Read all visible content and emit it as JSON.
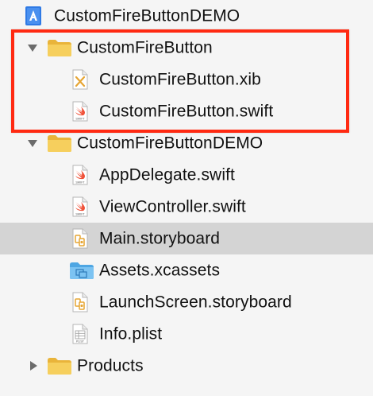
{
  "colors": {
    "background": "#f5f5f5",
    "selected_row": "#d4d4d4",
    "highlight_border": "#ff2a12",
    "folder_yellow": "#f5c84a",
    "folder_blue": "#67b8ec",
    "swift_orange": "#f05138"
  },
  "navigator": {
    "items": [
      {
        "label": "CustomFireButtonDEMO",
        "kind": "project",
        "icon": "project-icon",
        "disclosure": "expanded"
      },
      {
        "label": "CustomFireButton",
        "kind": "group",
        "icon": "folder-icon",
        "disclosure": "expanded"
      },
      {
        "label": "CustomFireButton.xib",
        "kind": "file",
        "icon": "xib-file-icon"
      },
      {
        "label": "CustomFireButton.swift",
        "kind": "file",
        "icon": "swift-file-icon",
        "badge": "SWIFT"
      },
      {
        "label": "CustomFireButtonDEMO",
        "kind": "group",
        "icon": "folder-icon",
        "disclosure": "expanded"
      },
      {
        "label": "AppDelegate.swift",
        "kind": "file",
        "icon": "swift-file-icon",
        "badge": "SWIFT"
      },
      {
        "label": "ViewController.swift",
        "kind": "file",
        "icon": "swift-file-icon",
        "badge": "SWIFT"
      },
      {
        "label": "Main.storyboard",
        "kind": "file",
        "icon": "storyboard-file-icon",
        "selected": true
      },
      {
        "label": "Assets.xcassets",
        "kind": "folder",
        "icon": "asset-catalog-icon"
      },
      {
        "label": "LaunchScreen.storyboard",
        "kind": "file",
        "icon": "storyboard-file-icon"
      },
      {
        "label": "Info.plist",
        "kind": "file",
        "icon": "plist-file-icon",
        "badge": "PLIST"
      },
      {
        "label": "Products",
        "kind": "group",
        "icon": "folder-icon",
        "disclosure": "collapsed"
      }
    ]
  }
}
